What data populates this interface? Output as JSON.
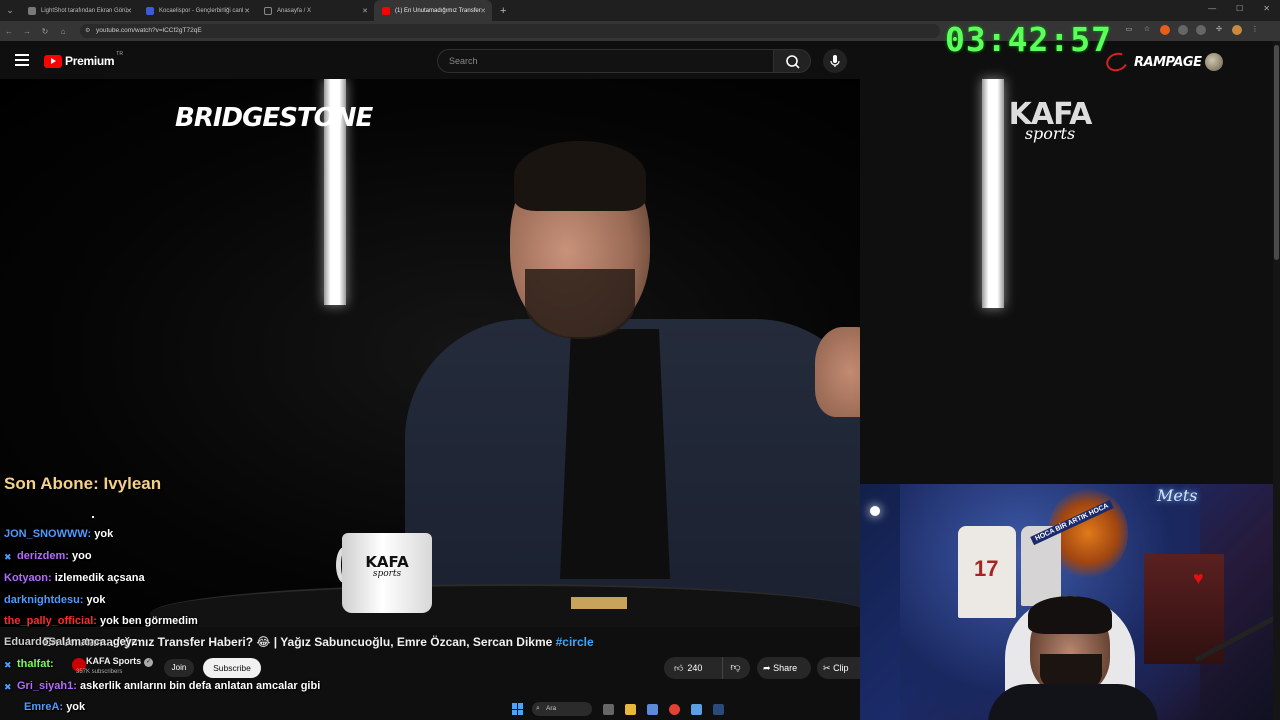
{
  "browser": {
    "tabs": [
      {
        "label": "LightShot tarafından Ekran Görü",
        "favicon_color": "#7a7a7a",
        "active": false
      },
      {
        "label": "Kocaelispor - Gençlerbirliği canl",
        "favicon_color": "#3b5bdb",
        "active": false
      },
      {
        "label": "Anasayfa / X",
        "favicon_color": "#222222",
        "active": false
      },
      {
        "label": "(1) En Unutamadığımız Transfer",
        "favicon_color": "#ff0000",
        "active": true
      }
    ],
    "url": "youtube.com/watch?v=lCCf2gT72qE"
  },
  "youtube": {
    "logo_text": "Premium",
    "country_code": "TR",
    "search_placeholder": "Search"
  },
  "overlay": {
    "timer": "03:42:57",
    "brand": "RAMPAGE",
    "last_subscriber": "Son Abone: Ivylean"
  },
  "video": {
    "sponsor_logo": "BRIDGESTONE",
    "channel_logo_main": "KAFA",
    "channel_logo_sub": "sports",
    "mug_main": "KAFA",
    "mug_sub": "sports",
    "title_prefix": "En Unutamadığımız Transfer Haberi? 😂 | Yağız Sabuncuoğlu, Emre Özcan, Sercan Dikme ",
    "title_hashtag": "#circle",
    "channel_name": "KAFA Sports",
    "channel_subs": "357K subscribers",
    "join_label": "Join",
    "subscribe_label": "Subscribe",
    "like_count": "240",
    "share_label": "Share",
    "clip_label": "Clip"
  },
  "chat": [
    {
      "user": "JON_SNOWWW:",
      "msg": "yok",
      "color": "#4d9bff",
      "badge": ""
    },
    {
      "user": "derizdem:",
      "msg": "yoo",
      "color": "#b46bff",
      "badge": "✖"
    },
    {
      "user": "Kotyaon:",
      "msg": "izlemedik açsana",
      "color": "#b46bff",
      "badge": ""
    },
    {
      "user": "darknightdesu:",
      "msg": "yok",
      "color": "#4d9bff",
      "badge": ""
    },
    {
      "user": "the_pally_official:",
      "msg": "yok ben görmedim",
      "color": "#ff2a2a",
      "badge": ""
    },
    {
      "user": "EduardoSalamanca:",
      "msg": "geyz",
      "color": "#e0e0e0",
      "badge": ""
    },
    {
      "user": "thalfat:",
      "msg": "",
      "color": "#7cfc5a",
      "badge": "✖"
    },
    {
      "user": "Gri_siyah1:",
      "msg": "askerlik anılarını bin defa anlatan amcalar gibi",
      "color": "#b46bff",
      "badge": "✖"
    },
    {
      "user": "EmreA:",
      "msg": "yok",
      "color": "#4d9bff",
      "badge": ""
    }
  ],
  "webcam": {
    "jersey_number": "17",
    "banner_text": "HOCA BİR ARTIK HOCA",
    "neon_sign": "Mets"
  },
  "taskbar": {
    "search_label": "Ara"
  },
  "colors": {
    "timer_green": "#5cff5c",
    "youtube_red": "#ff0000",
    "last_sub_gold": "#f4d089",
    "hashtag_blue": "#3ea6ff"
  }
}
